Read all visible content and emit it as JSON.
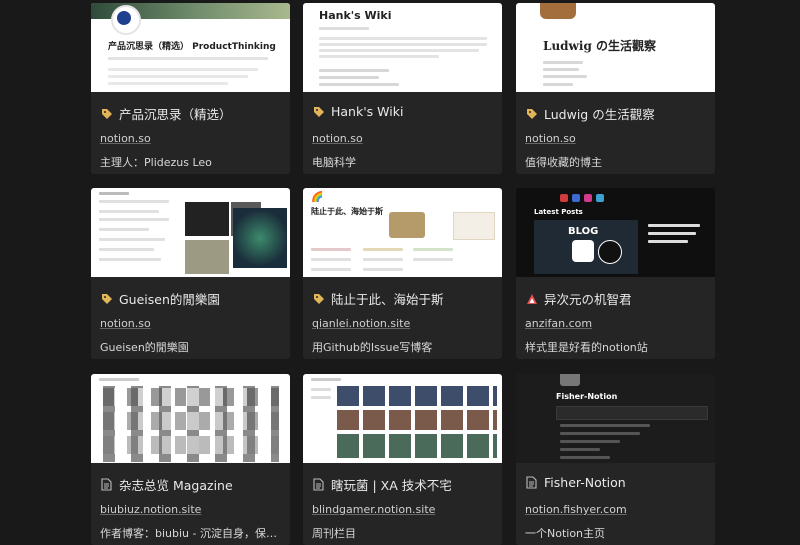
{
  "cards": [
    {
      "title": "产品沉思录（精选）",
      "url": "notion.so",
      "desc": "主理人：Plidezus Leo",
      "icon": "tag-icon",
      "preview": {
        "heading": "产品沉思录（精选） ProductThinking"
      }
    },
    {
      "title": "Hank's Wiki",
      "url": "notion.so",
      "desc": "电脑科学",
      "icon": "tag-icon",
      "preview": {
        "heading": "Hank's Wiki"
      }
    },
    {
      "title": "Ludwig の生活觀察",
      "url": "notion.so",
      "desc": "值得收藏的博主",
      "icon": "tag-icon",
      "preview": {
        "heading": "Ludwig の生活觀察"
      }
    },
    {
      "title": "Gueisen的閒樂園",
      "url": "notion.so",
      "desc": "Gueisen的閒樂園",
      "icon": "tag-icon",
      "preview": {}
    },
    {
      "title": "陆止于此、海始于斯",
      "url": "qianlei.notion.site",
      "desc": "用Github的Issue写博客",
      "icon": "tag-icon",
      "preview": {
        "heading": "陆止于此、海始于斯"
      }
    },
    {
      "title": "异次元の机智君",
      "url": "anzifan.com",
      "desc": "样式里是好看的notion站",
      "icon": "site-logo-icon",
      "preview": {
        "heading": "Latest Posts",
        "sub": "BLOG"
      }
    },
    {
      "title": "杂志总览 Magazine",
      "url": "biubiuz.notion.site",
      "desc": "作者博客：biubiu - 沉淀自身，保持…",
      "icon": "page-icon",
      "preview": {}
    },
    {
      "title": "瞎玩菌 | XA 技术不宅",
      "url": "blindgamer.notion.site",
      "desc": "周刊栏目",
      "icon": "page-icon",
      "preview": {}
    },
    {
      "title": "Fisher-Notion",
      "url": "notion.fishyer.com",
      "desc": "一个Notion主页",
      "icon": "page-icon",
      "preview": {
        "heading": "Fisher-Notion"
      }
    }
  ]
}
